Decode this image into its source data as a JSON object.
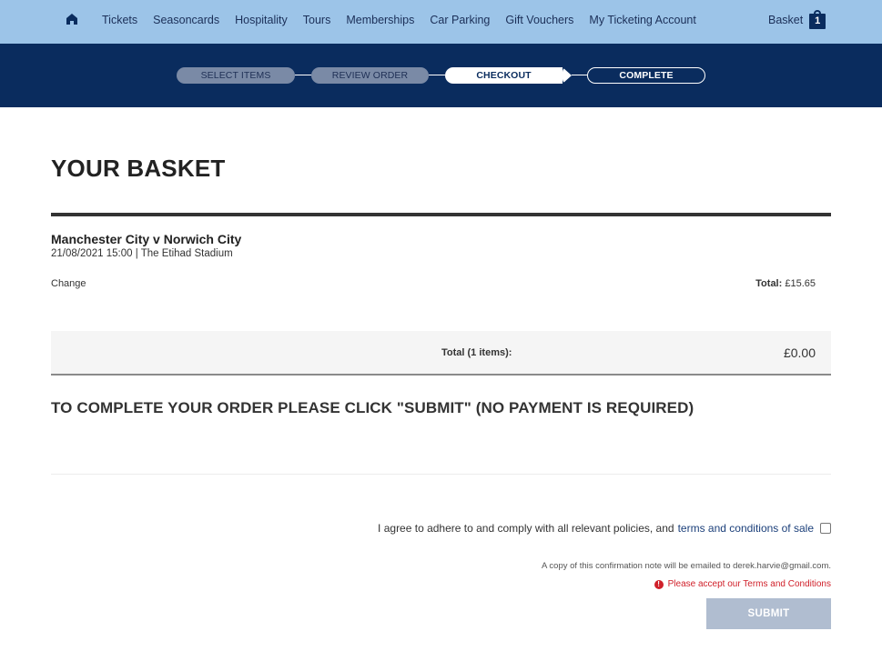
{
  "nav": {
    "home_icon": "home-icon",
    "links": [
      "Tickets",
      "Seasoncards",
      "Hospitality",
      "Tours",
      "Memberships",
      "Car Parking",
      "Gift Vouchers",
      "My Ticketing Account"
    ],
    "basket_label": "Basket",
    "basket_count": "1"
  },
  "progress": {
    "steps": [
      {
        "label": "SELECT ITEMS",
        "state": "done"
      },
      {
        "label": "REVIEW ORDER",
        "state": "done"
      },
      {
        "label": "CHECKOUT",
        "state": "active"
      },
      {
        "label": "COMPLETE",
        "state": "todo"
      }
    ]
  },
  "basket": {
    "title": "YOUR BASKET",
    "item": {
      "event": "Manchester City v Norwich City",
      "meta": "21/08/2021 15:00  |  The Etihad Stadium",
      "change_label": "Change",
      "total_label": "Total:",
      "total_value": "£15.65"
    },
    "summary": {
      "label": "Total (1 items):",
      "value": "£0.00"
    }
  },
  "checkout": {
    "notice": "TO COMPLETE YOUR ORDER PLEASE CLICK \"SUBMIT\" (NO PAYMENT IS REQUIRED)",
    "agree_text": "I agree to adhere to and comply with all relevant policies, and",
    "terms_link": "terms and conditions of sale",
    "email_note": "A copy of this confirmation note will be emailed to derek.harvie@gmail.com.",
    "error_message": "Please accept our Terms and Conditions",
    "submit_label": "SUBMIT"
  },
  "colors": {
    "nav_bg": "#9cc4e8",
    "progress_bg": "#0a2c5e",
    "error": "#d0202a",
    "submit_disabled": "#b0bdd0"
  }
}
